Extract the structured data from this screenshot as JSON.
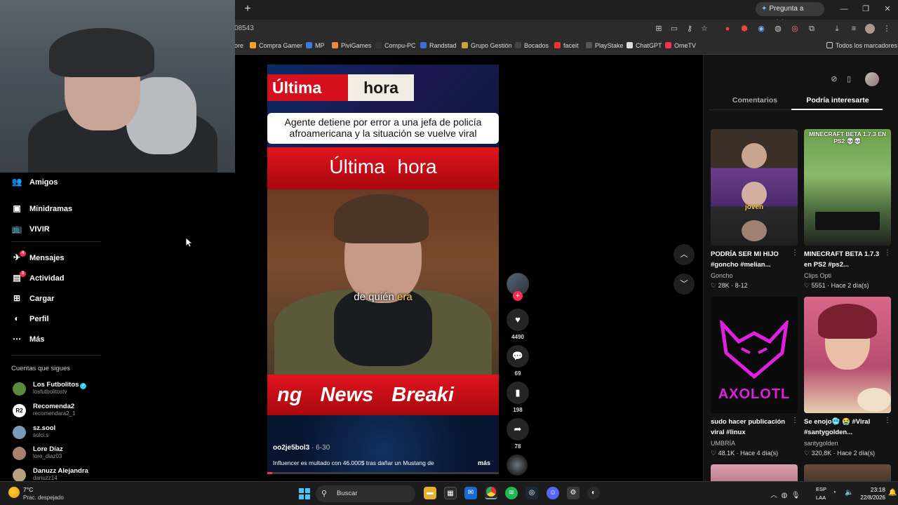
{
  "browser": {
    "gemini_label": "Pregunta a Gemini",
    "url_fragment": "08543",
    "bookmarks": [
      "ore",
      "Compra Gamer",
      "MP",
      "PiviGames",
      "Compu-PC",
      "Randstad",
      "Grupo Gestión",
      "Bocados",
      "faceit",
      "PlayStake",
      "ChatGPT",
      "OmeTV"
    ],
    "all_bookmarks": "Todos los marcadores"
  },
  "sidebar": {
    "items": [
      {
        "label": "Amigos",
        "icon": "friends-icon"
      },
      {
        "label": "Minidramas",
        "icon": "minidramas-icon"
      },
      {
        "label": "VIVIR",
        "icon": "live-icon"
      },
      {
        "label": "Mensajes",
        "icon": "messages-icon",
        "badge": "4"
      },
      {
        "label": "Actividad",
        "icon": "activity-icon",
        "badge": "3"
      },
      {
        "label": "Cargar",
        "icon": "upload-icon"
      },
      {
        "label": "Perfil",
        "icon": "profile-icon"
      },
      {
        "label": "Más",
        "icon": "more-icon"
      }
    ],
    "following_title": "Cuentas que sigues",
    "following": [
      {
        "name": "Los Futbolitos",
        "handle": "losfutbolitostv",
        "verified": true
      },
      {
        "name": "Recomenda2",
        "handle": "recomendara2_1"
      },
      {
        "name": "sz.sool",
        "handle": "solci.s"
      },
      {
        "name": "Lore Díaz",
        "handle": "lore_diaz03"
      },
      {
        "name": "Danuzz Alejandra",
        "handle": "danuzz14"
      }
    ]
  },
  "video": {
    "banner_word1": "Última",
    "banner_word2": "hora",
    "headline": "Agente detiene por error a una jefa de policía afroamericana y la situación se vuelve viral",
    "banner2": "Última hora",
    "caption_main": "de quién ",
    "caption_highlight": "era",
    "breaking": "ng News Breaki",
    "author": "oo2je5bol3",
    "date": " · 6-30",
    "description": "Influencer es multado con 46.000$ tras dañar un Mustang de",
    "more": "más",
    "progress": 0.02
  },
  "actions": {
    "likes": "4490",
    "comments": "69",
    "saves": "198",
    "shares": "78"
  },
  "right_panel": {
    "tab_comments": "Comentarios",
    "tab_interest": "Podría interesarte",
    "cards": [
      {
        "title": "PODRÍA SER MI HIJO #goncho #melian...",
        "author": "Goncho",
        "likes": "28K",
        "when": "8-12",
        "overlay": "joven"
      },
      {
        "title": "MINECRAFT BETA 1.7.3 en PS2 #ps2...",
        "author": "Clips Opti",
        "likes": "5551",
        "when": "Hace 2 día(s)",
        "overlay": "MINECRAFT BETA 1.7.3 EN PS2 💀💀"
      },
      {
        "title": "sudo hacer publicación viral #linux",
        "author": "UMBRÍA",
        "likes": "48.1K",
        "when": "Hace 4 día(s)",
        "overlay": "AXOLOTL"
      },
      {
        "title": "Se enojo🥶 😭 #Viral #santygolden...",
        "author": "santygolden",
        "likes": "320,8K",
        "when": "Hace 2 día(s)"
      }
    ]
  },
  "taskbar": {
    "temp": "7°C",
    "weather": "Prac. despejado",
    "search_placeholder": "Buscar",
    "lang1": "ESP",
    "lang2": "LAA",
    "time": "23:18",
    "date": "22/8/2026"
  }
}
